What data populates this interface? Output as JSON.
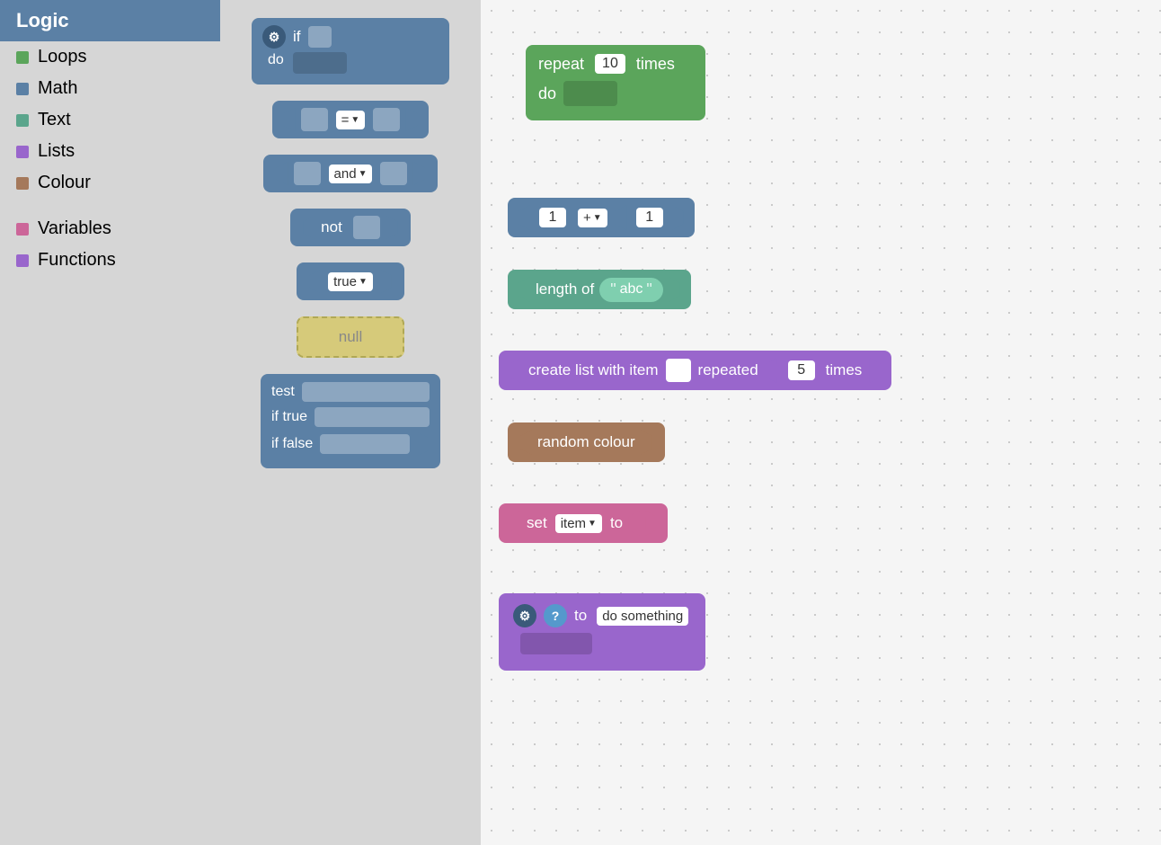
{
  "sidebar": {
    "items": [
      {
        "id": "logic",
        "label": "Logic",
        "color": "#5b80a5",
        "isActive": true
      },
      {
        "id": "loops",
        "label": "Loops",
        "color": "#5ba55b"
      },
      {
        "id": "math",
        "label": "Math",
        "color": "#5b80a5"
      },
      {
        "id": "text",
        "label": "Text",
        "color": "#5ba58c"
      },
      {
        "id": "lists",
        "label": "Lists",
        "color": "#9966cc"
      },
      {
        "id": "colour",
        "label": "Colour",
        "color": "#a5795b"
      },
      {
        "id": "variables",
        "label": "Variables",
        "color": "#cc6699"
      },
      {
        "id": "functions",
        "label": "Functions",
        "color": "#9966cc"
      }
    ]
  },
  "palette": {
    "blocks": [
      {
        "id": "if",
        "type": "if",
        "label": "if",
        "sublabels": [
          "do"
        ]
      },
      {
        "id": "equals",
        "type": "comparison",
        "label": "="
      },
      {
        "id": "and",
        "type": "logic",
        "label": "and"
      },
      {
        "id": "not",
        "type": "logic",
        "label": "not"
      },
      {
        "id": "true",
        "type": "value",
        "label": "true"
      },
      {
        "id": "null",
        "type": "value",
        "label": "null"
      },
      {
        "id": "ternary",
        "type": "ternary",
        "labels": [
          "test",
          "if true",
          "if false"
        ]
      }
    ]
  },
  "canvas": {
    "blocks": [
      {
        "id": "repeat",
        "type": "repeat",
        "label": "repeat",
        "times_label": "times",
        "do_label": "do",
        "value": "10"
      },
      {
        "id": "math_add",
        "type": "math",
        "left": "1",
        "op": "+",
        "right": "1"
      },
      {
        "id": "text_length",
        "type": "text_op",
        "label": "length of",
        "text_value": "abc"
      },
      {
        "id": "list_repeat",
        "type": "list",
        "label": "create list with item",
        "repeated_label": "repeated",
        "times_label": "times",
        "value": "5"
      },
      {
        "id": "random_colour",
        "type": "colour",
        "label": "random colour"
      },
      {
        "id": "set_var",
        "type": "variable",
        "set_label": "set",
        "var_name": "item",
        "to_label": "to"
      },
      {
        "id": "func_def",
        "type": "function",
        "to_label": "to",
        "name": "do something"
      }
    ]
  },
  "icons": {
    "gear": "⚙",
    "question": "?",
    "dropdown_arrow": "▼"
  }
}
